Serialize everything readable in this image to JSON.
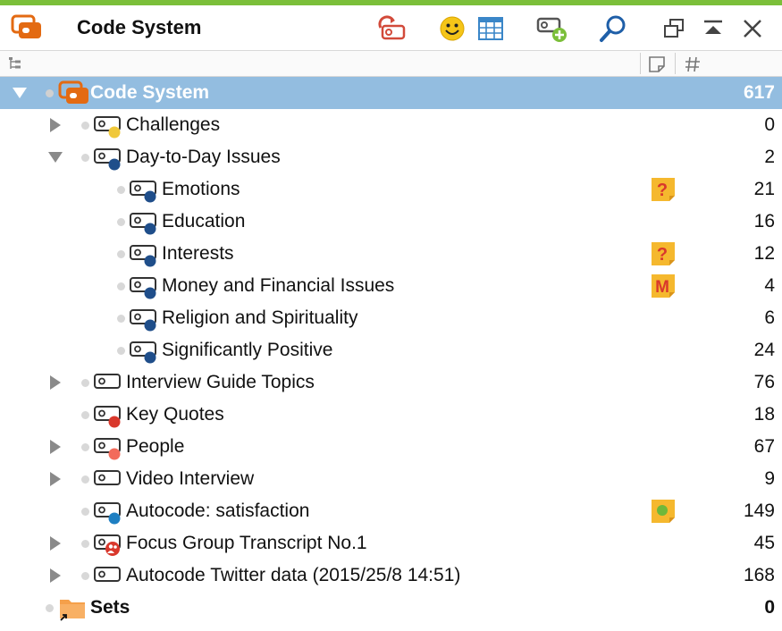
{
  "window": {
    "title": "Code System",
    "accent_color": "#7bbf3a",
    "toolbar": [
      {
        "name": "reset-activations-icon"
      },
      {
        "name": "smiley-icon"
      },
      {
        "name": "table-icon"
      },
      {
        "name": "new-code-icon"
      },
      {
        "name": "search-icon"
      },
      {
        "name": "undock-window-icon"
      },
      {
        "name": "collapse-window-icon"
      },
      {
        "name": "close-icon"
      }
    ]
  },
  "columns": [
    {
      "name": "tree-column-icon"
    },
    {
      "name": "memo-column-icon"
    },
    {
      "name": "count-column-icon"
    }
  ],
  "tree": {
    "selection_color": "#93bde0",
    "root": {
      "label": "Code System",
      "count": "617"
    },
    "rows": [
      {
        "label": "Challenges",
        "count": "0",
        "depth": 1,
        "arrow": "collapsed",
        "color": "#f0c83a",
        "icon": "code",
        "memo": ""
      },
      {
        "label": "Day-to-Day Issues",
        "count": "2",
        "depth": 1,
        "arrow": "expanded",
        "color": "#1f4e8a",
        "icon": "code",
        "memo": ""
      },
      {
        "label": "Emotions",
        "count": "21",
        "depth": 2,
        "arrow": "",
        "color": "#1f4e8a",
        "icon": "code",
        "memo": "?"
      },
      {
        "label": "Education",
        "count": "16",
        "depth": 2,
        "arrow": "",
        "color": "#1f4e8a",
        "icon": "code",
        "memo": ""
      },
      {
        "label": "Interests",
        "count": "12",
        "depth": 2,
        "arrow": "",
        "color": "#1f4e8a",
        "icon": "code",
        "memo": "?"
      },
      {
        "label": "Money and Financial Issues",
        "count": "4",
        "depth": 2,
        "arrow": "",
        "color": "#1f4e8a",
        "icon": "code",
        "memo": "M"
      },
      {
        "label": "Religion and Spirituality",
        "count": "6",
        "depth": 2,
        "arrow": "",
        "color": "#1f4e8a",
        "icon": "code",
        "memo": ""
      },
      {
        "label": "Significantly Positive",
        "count": "24",
        "depth": 2,
        "arrow": "",
        "color": "#1f4e8a",
        "icon": "code",
        "memo": ""
      },
      {
        "label": "Interview Guide Topics",
        "count": "76",
        "depth": 1,
        "arrow": "collapsed",
        "color": "",
        "icon": "code",
        "memo": ""
      },
      {
        "label": "Key Quotes",
        "count": "18",
        "depth": 1,
        "arrow": "",
        "color": "#d9382c",
        "icon": "code",
        "memo": ""
      },
      {
        "label": "People",
        "count": "67",
        "depth": 1,
        "arrow": "collapsed",
        "color": "#f26b5b",
        "icon": "code",
        "memo": ""
      },
      {
        "label": "Video Interview",
        "count": "9",
        "depth": 1,
        "arrow": "collapsed",
        "color": "",
        "icon": "code",
        "memo": ""
      },
      {
        "label": "Autocode: satisfaction",
        "count": "149",
        "depth": 1,
        "arrow": "",
        "color": "#1e7fc2",
        "icon": "code",
        "memo": "dot"
      },
      {
        "label": "Focus Group Transcript No.1",
        "count": "45",
        "depth": 1,
        "arrow": "collapsed",
        "color": "",
        "icon": "focus",
        "memo": ""
      },
      {
        "label": "Autocode Twitter data (2015/25/8 14:51)",
        "count": "168",
        "depth": 1,
        "arrow": "collapsed",
        "color": "",
        "icon": "code",
        "memo": ""
      }
    ],
    "sets": {
      "label": "Sets",
      "count": "0"
    }
  }
}
